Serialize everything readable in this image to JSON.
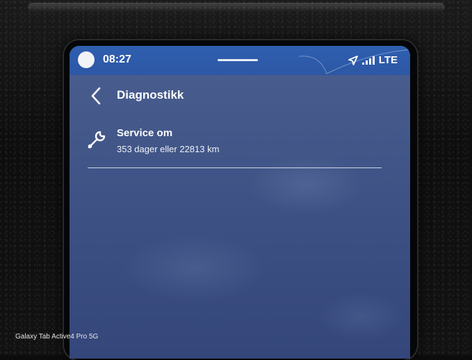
{
  "status_bar": {
    "time": "08:27",
    "network": "LTE",
    "icons": [
      "avatar-icon",
      "navigation-arrow-icon",
      "signal-icon"
    ]
  },
  "header": {
    "title": "Diagnostikk",
    "back_icon": "chevron-left-icon"
  },
  "service": {
    "icon": "wrench-icon",
    "title": "Service om",
    "detail": "353 dager eller 22813 km"
  },
  "watermark": {
    "text": "Galaxy Tab Active4 Pro 5G"
  },
  "colors": {
    "status_bar": "#2c57a4",
    "screen_background": "#3f5386",
    "text": "#ffffff"
  }
}
